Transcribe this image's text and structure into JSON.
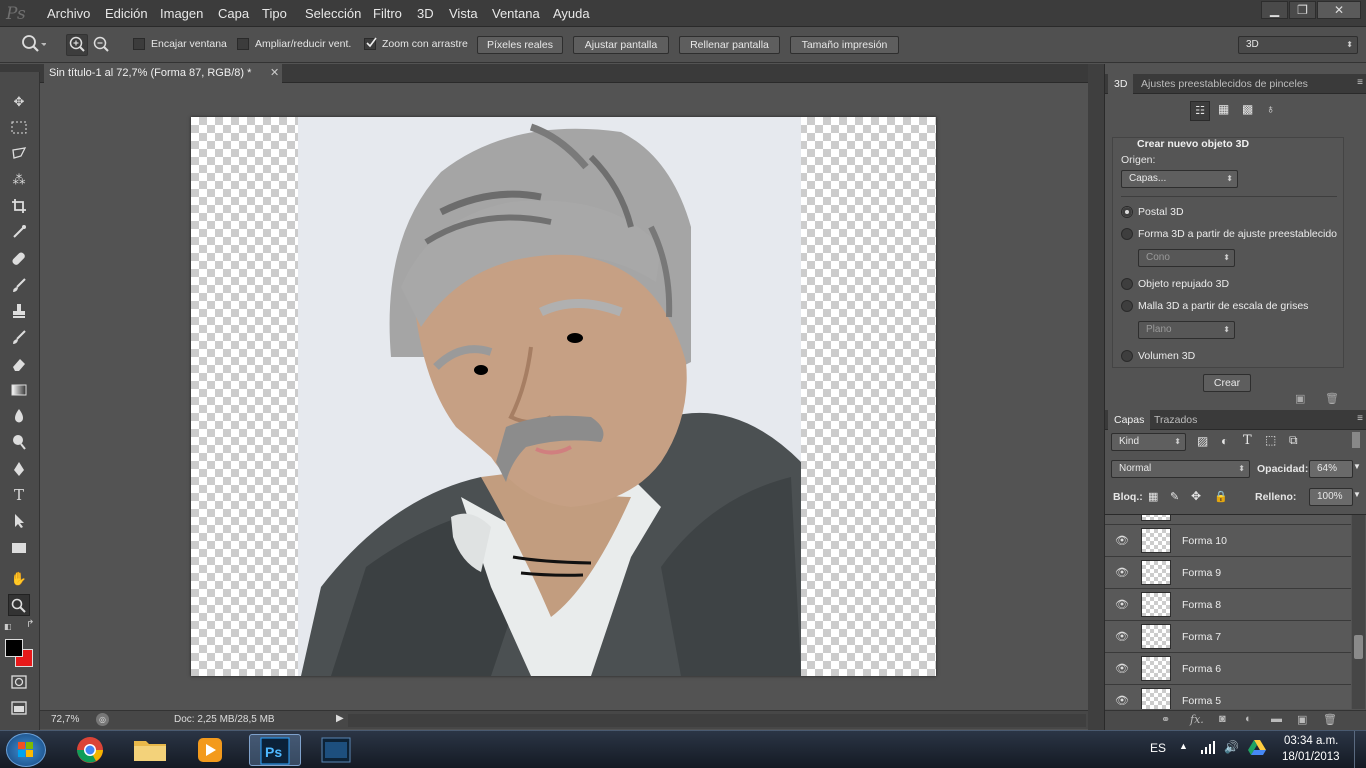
{
  "menubar": {
    "logo": "Ps",
    "items": [
      "Archivo",
      "Edición",
      "Imagen",
      "Capa",
      "Tipo",
      "Selección",
      "Filtro",
      "3D",
      "Vista",
      "Ventana",
      "Ayuda"
    ]
  },
  "window_controls": {
    "minimize": "▁",
    "restore": "❐",
    "close": "✕"
  },
  "options": {
    "fit_window_label": "Encajar ventana",
    "resize_label": "Ampliar/reducir vent.",
    "scrubby_zoom_label": "Zoom con arrastre",
    "scrubby_zoom_checked": true,
    "actual_pixels": "Píxeles reales",
    "fit_screen": "Ajustar pantalla",
    "fill_screen": "Rellenar pantalla",
    "print_size": "Tamaño impresión",
    "workspace": "3D"
  },
  "document": {
    "tab_title": "Sin título-1 al 72,7% (Forma 87, RGB/8) *",
    "close": "✕"
  },
  "status": {
    "zoom": "72,7%",
    "doc_info": "Doc: 2,25 MB/28,5 MB"
  },
  "panel_3d": {
    "tabs": [
      "3D",
      "Ajustes preestablecidos de pinceles"
    ],
    "section_title": "Crear nuevo objeto 3D",
    "source_label": "Origen:",
    "source_value": "Capas...",
    "options": [
      {
        "label": "Postal 3D",
        "selected": true
      },
      {
        "label": "Forma 3D a partir de ajuste preestablecido",
        "selected": false
      },
      {
        "label": "Objeto repujado 3D",
        "selected": false
      },
      {
        "label": "Malla 3D a partir de escala de grises",
        "selected": false
      },
      {
        "label": "Volumen 3D",
        "selected": false
      }
    ],
    "preset_shape": "Cono",
    "grayscale_mesh": "Plano",
    "create_button": "Crear"
  },
  "layers_panel": {
    "tabs": [
      "Capas",
      "Trazados"
    ],
    "filter": "Kind",
    "blend_mode": "Normal",
    "opacity_label": "Opacidad:",
    "opacity_value": "64%",
    "lock_label": "Bloq.:",
    "fill_label": "Relleno:",
    "fill_value": "100%",
    "layers": [
      "Forma 10",
      "Forma 9",
      "Forma 8",
      "Forma 7",
      "Forma 6",
      "Forma 5"
    ]
  },
  "taskbar": {
    "language": "ES",
    "time": "03:34 a.m.",
    "date": "18/01/2013"
  },
  "colors": {
    "foreground": "#000000",
    "background": "#e8191a",
    "panel_bg": "#535353",
    "chrome_dark": "#3c3c3c"
  }
}
